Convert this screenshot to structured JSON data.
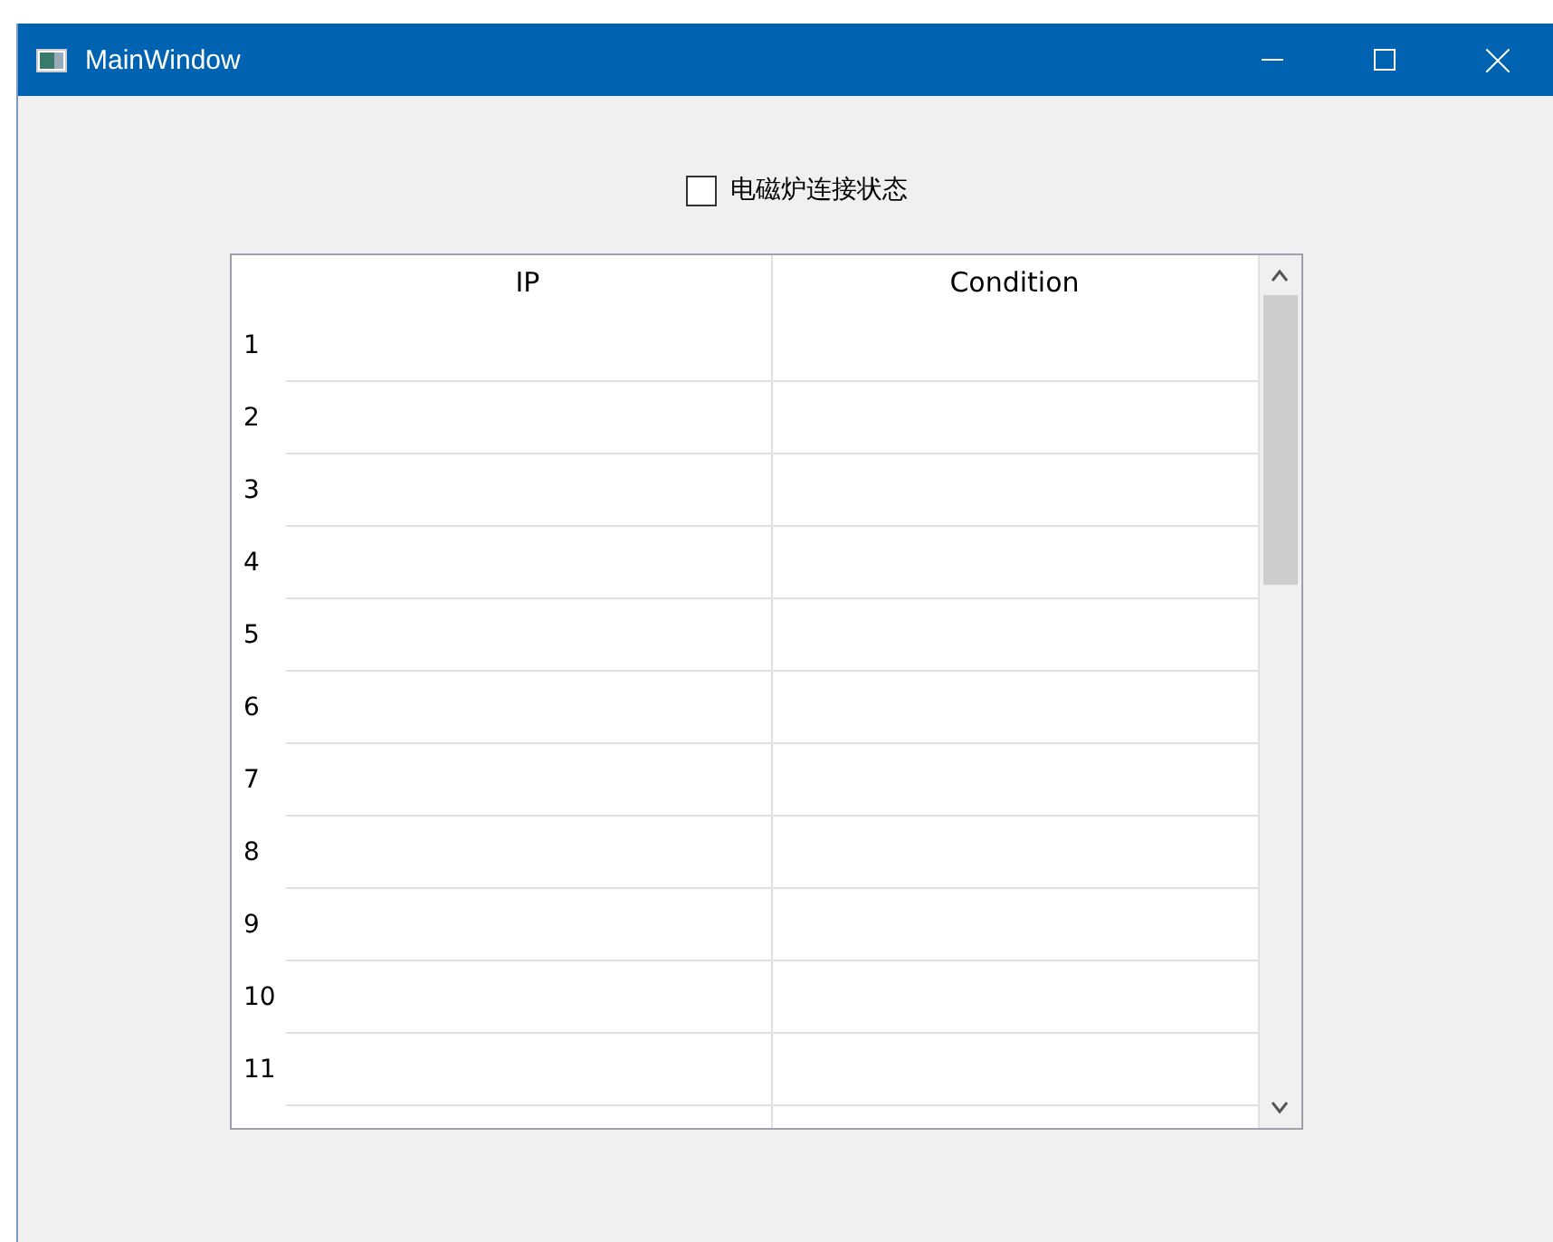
{
  "window": {
    "title": "MainWindow"
  },
  "checkbox": {
    "label": "电磁炉连接状态",
    "checked": false
  },
  "table": {
    "columns": [
      "IP",
      "Condition"
    ],
    "rows": [
      {
        "header": "1"
      },
      {
        "header": "2"
      },
      {
        "header": "3"
      },
      {
        "header": "4"
      },
      {
        "header": "5"
      },
      {
        "header": "6"
      },
      {
        "header": "7"
      },
      {
        "header": "8"
      },
      {
        "header": "9"
      },
      {
        "header": "10"
      },
      {
        "header": "11"
      }
    ]
  }
}
